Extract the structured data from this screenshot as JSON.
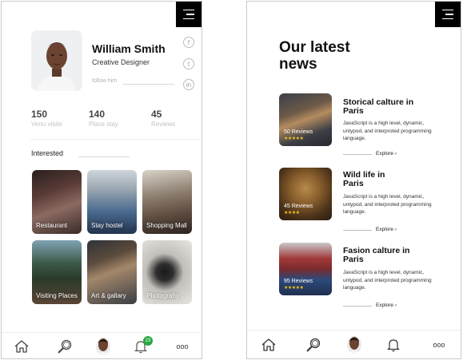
{
  "profile": {
    "name": "William Smith",
    "role": "Creative Designer",
    "follow_label": "follow him",
    "social": [
      "f",
      "t",
      "in"
    ],
    "stats": [
      {
        "value": "150",
        "label": "Venu visite"
      },
      {
        "value": "140",
        "label": "Place stay"
      },
      {
        "value": "45",
        "label": "Reviews"
      }
    ],
    "interested_label": "Interested",
    "tiles": [
      {
        "label": "Restaurant"
      },
      {
        "label": "Stay hostel"
      },
      {
        "label": "Shopping Mall"
      },
      {
        "label": "Visiting Places"
      },
      {
        "label": "Art & gallary"
      },
      {
        "label": "Photograhy"
      }
    ],
    "nav": {
      "badge": "23",
      "more": "ooo"
    }
  },
  "news": {
    "title": "Our latest news",
    "articles": [
      {
        "title": "Storical calture in Paris",
        "reviews": "50 Reviews",
        "stars": "★★★★★",
        "text": "JavaScript is a high level, dynamic, untypod, and interproted programming language.",
        "explore": "Explore"
      },
      {
        "title": "Wild life in Paris",
        "reviews": "45 Reviews",
        "stars": "★★★★",
        "text": "JavaScript is a high level, dynamic, untypod, and interproted programming language.",
        "explore": "Explore"
      },
      {
        "title": "Fasion calture in Paris",
        "reviews": "95 Reviews",
        "stars": "★★★★★",
        "text": "JavaScript is a high level, dynamic, untypod, and interproted programming language.",
        "explore": "Explore"
      }
    ],
    "nav": {
      "more": "ooo"
    }
  }
}
